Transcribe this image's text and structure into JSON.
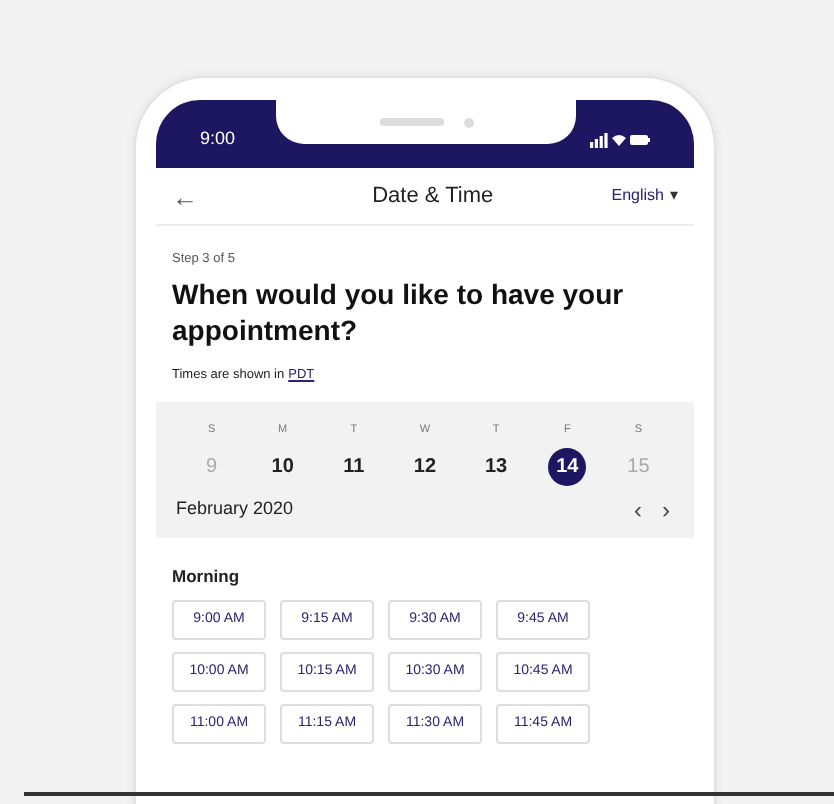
{
  "status_bar": {
    "time": "9:00"
  },
  "header": {
    "back": "←",
    "title": "Date & Time",
    "language": "English",
    "language_caret": "▾"
  },
  "intro": {
    "step": "Step 3 of 5",
    "heading": "When would you like to have your appointment?",
    "timezone_note": "Times are shown in",
    "timezone_link": "PDT"
  },
  "calendar": {
    "days": [
      {
        "weekday": "S",
        "date": "9",
        "disabled": true,
        "selected": false
      },
      {
        "weekday": "M",
        "date": "10",
        "disabled": false,
        "selected": false
      },
      {
        "weekday": "T",
        "date": "11",
        "disabled": false,
        "selected": false
      },
      {
        "weekday": "W",
        "date": "12",
        "disabled": false,
        "selected": false
      },
      {
        "weekday": "T",
        "date": "13",
        "disabled": false,
        "selected": false
      },
      {
        "weekday": "F",
        "date": "14",
        "disabled": false,
        "selected": true
      },
      {
        "weekday": "S",
        "date": "15",
        "disabled": true,
        "selected": false
      }
    ],
    "month": "February 2020",
    "prev": "‹",
    "next": "›"
  },
  "sections": [
    {
      "title": "Morning",
      "slots": [
        "9:00 AM",
        "9:15 AM",
        "9:30 AM",
        "9:45 AM",
        "10:00 AM",
        "10:15 AM",
        "10:30 AM",
        "10:45 AM",
        "11:00 AM",
        "11:15 AM",
        "11:30 AM",
        "11:45 AM"
      ]
    }
  ]
}
